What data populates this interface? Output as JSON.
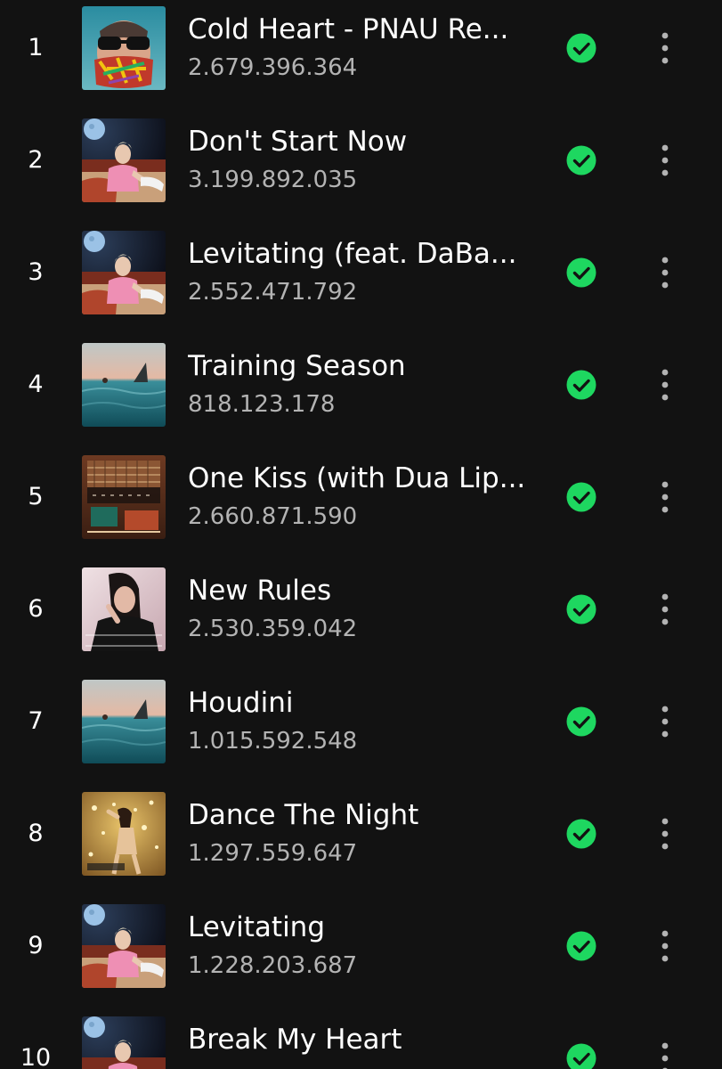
{
  "colors": {
    "background": "#121212",
    "text_primary": "#ffffff",
    "text_secondary": "#b3b3b3",
    "downloaded_accent": "#1ed760"
  },
  "icons": {
    "downloaded": "check-circle-icon",
    "more": "more-vertical-icon"
  },
  "tracks": [
    {
      "rank": "1",
      "title": "Cold Heart - PNAU Re...",
      "plays": "2.679.396.364",
      "art": "art-cold-heart"
    },
    {
      "rank": "2",
      "title": "Don't Start Now",
      "plays": "3.199.892.035",
      "art": "art-future-nostalgia"
    },
    {
      "rank": "3",
      "title": "Levitating (feat. DaBa...",
      "plays": "2.552.471.792",
      "art": "art-future-nostalgia"
    },
    {
      "rank": "4",
      "title": "Training Season",
      "plays": "818.123.178",
      "art": "art-radical-optimism-sea"
    },
    {
      "rank": "5",
      "title": "One Kiss (with Dua Lip...",
      "plays": "2.660.871.590",
      "art": "art-96-months"
    },
    {
      "rank": "6",
      "title": "New Rules",
      "plays": "2.530.359.042",
      "art": "art-dua-lipa"
    },
    {
      "rank": "7",
      "title": "Houdini",
      "plays": "1.015.592.548",
      "art": "art-radical-optimism-sea"
    },
    {
      "rank": "8",
      "title": "Dance The Night",
      "plays": "1.297.559.647",
      "art": "art-barbie-album"
    },
    {
      "rank": "9",
      "title": "Levitating",
      "plays": "1.228.203.687",
      "art": "art-future-nostalgia"
    },
    {
      "rank": "10",
      "title": "Break My Heart",
      "plays": "",
      "art": "art-future-nostalgia"
    }
  ]
}
